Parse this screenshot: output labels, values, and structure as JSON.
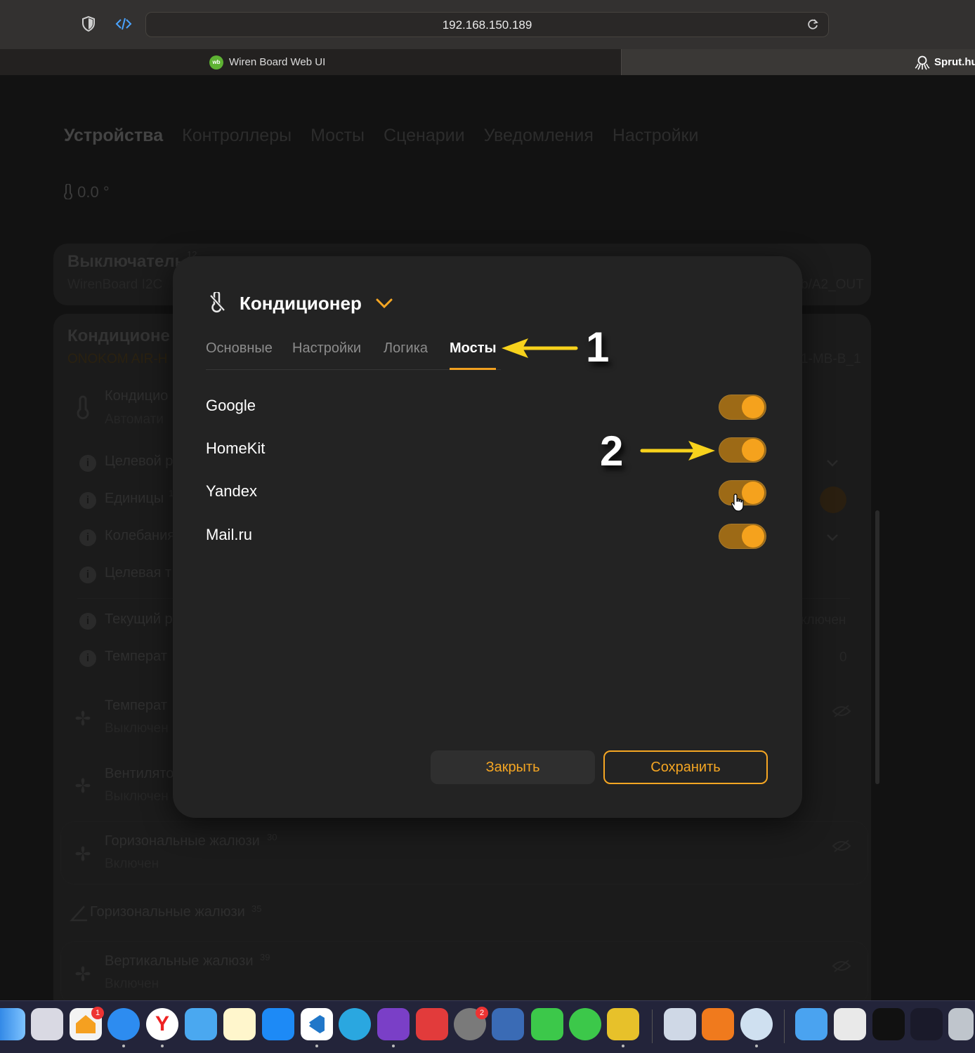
{
  "browser": {
    "url": "192.168.150.189",
    "tabs": [
      {
        "title": "Wiren Board Web UI",
        "favicon": "wb"
      },
      {
        "title": "Sprut.hu"
      }
    ]
  },
  "background_page": {
    "nav": [
      "Устройства",
      "Контроллеры",
      "Мосты",
      "Сценарии",
      "Уведомления",
      "Настройки"
    ],
    "temperature": "0.0 °",
    "card1": {
      "title": "Выключатель",
      "sup": "12",
      "subtitle": "WirenBoard I2C",
      "right": "b/A2_OUT"
    },
    "card2": {
      "title": "Кондиционе",
      "subtitle": "ONOKOM AIR-H",
      "right": "1-MB-B_1"
    },
    "rows": [
      {
        "label": "Кондицио",
        "sub": "Автомати"
      },
      {
        "label": "Целевой р"
      },
      {
        "label": "Единицы",
        "sup": "1"
      },
      {
        "label": "Колебания"
      },
      {
        "label": "Целевая т"
      },
      {
        "label": "Текущий р",
        "right": "ключен"
      },
      {
        "label": "Температ",
        "right": "0"
      },
      {
        "label": "Температ",
        "sub": "Выключен"
      },
      {
        "label": "Вентилято",
        "sub": "Выключен"
      },
      {
        "label": "Горизональные жалюзи",
        "sup": "30",
        "sub": "Включен"
      },
      {
        "label": "Горизональные жалюзи",
        "sup": "35"
      },
      {
        "label": "Вертикальные жалюзи",
        "sup": "39",
        "sub": "Включен"
      }
    ]
  },
  "modal": {
    "title": "Кондиционер",
    "tabs": [
      "Основные",
      "Настройки",
      "Логика",
      "Мосты"
    ],
    "active_tab": "Мосты",
    "bridges": [
      {
        "name": "Google",
        "enabled": true
      },
      {
        "name": "HomeKit",
        "enabled": true
      },
      {
        "name": "Yandex",
        "enabled": true
      },
      {
        "name": "Mail.ru",
        "enabled": true
      }
    ],
    "close_label": "Закрыть",
    "save_label": "Сохранить",
    "accent": "#f5a623"
  },
  "annotations": [
    {
      "number": "1",
      "color": "#f7d21c"
    },
    {
      "number": "2",
      "color": "#f7d21c"
    }
  ],
  "dock": {
    "badges": [
      "1",
      "2"
    ]
  }
}
